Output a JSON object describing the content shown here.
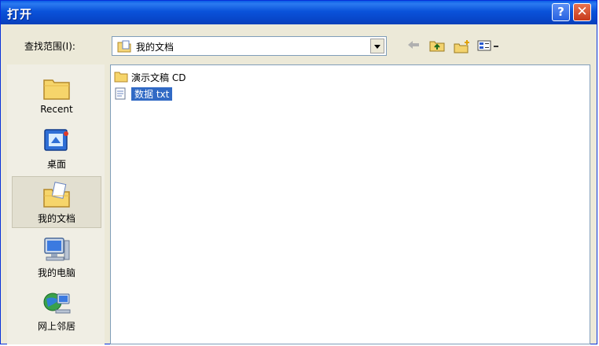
{
  "window": {
    "title": "打开",
    "help_label": "?",
    "close_label": "✕"
  },
  "lookin": {
    "label": "查找范围(I):",
    "value": "我的文档"
  },
  "toolbar": {
    "back_icon": "back-arrow-icon",
    "up_icon": "up-folder-icon",
    "newfolder_icon": "new-folder-icon",
    "views_icon": "views-menu-icon"
  },
  "places": [
    {
      "label": "Recent",
      "icon": "recent-folder-icon"
    },
    {
      "label": "桌面",
      "icon": "desktop-icon"
    },
    {
      "label": "我的文档",
      "icon": "my-documents-icon"
    },
    {
      "label": "我的电脑",
      "icon": "my-computer-icon"
    },
    {
      "label": "网上邻居",
      "icon": "network-places-icon"
    }
  ],
  "files": [
    {
      "name": "演示文稿 CD",
      "type": "folder",
      "selected": false
    },
    {
      "name": "数据 txt",
      "type": "text",
      "selected": true
    }
  ],
  "colors": {
    "titlebar": "#0a52da",
    "selection": "#316ac5",
    "dialog_bg": "#ece9d8"
  }
}
